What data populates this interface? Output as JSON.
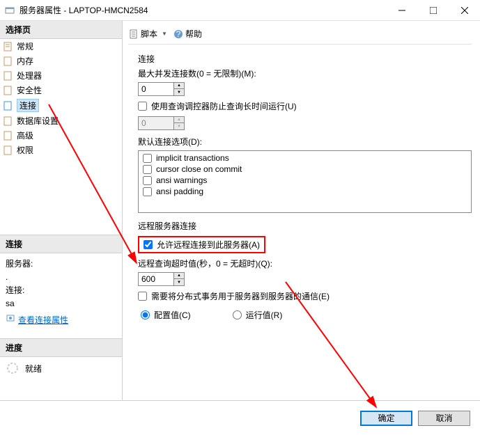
{
  "title": "服务器属性 - LAPTOP-HMCN2584",
  "sidebar": {
    "select_page": "选择页",
    "items": [
      {
        "label": "常规"
      },
      {
        "label": "内存"
      },
      {
        "label": "处理器"
      },
      {
        "label": "安全性"
      },
      {
        "label": "连接"
      },
      {
        "label": "数据库设置"
      },
      {
        "label": "高级"
      },
      {
        "label": "权限"
      }
    ],
    "connect_header": "连接",
    "server_label": "服务器:",
    "server_value": ".",
    "conn_label": "连接:",
    "conn_value": "sa",
    "view_props": "查看连接属性",
    "progress_header": "进度",
    "progress_status": "就绪"
  },
  "toolbar": {
    "script": "脚本",
    "help": "帮助"
  },
  "form": {
    "conn_label": "连接",
    "max_conn_label": "最大并发连接数(0 = 无限制)(M):",
    "max_conn_value": "0",
    "use_query_gov": "使用查询调控器防止查询长时间运行(U)",
    "gov_value": "0",
    "default_opts_label": "默认连接选项(D):",
    "opts": [
      "implicit transactions",
      "cursor close on commit",
      "ansi warnings",
      "ansi padding"
    ],
    "remote_header": "远程服务器连接",
    "allow_remote": "允许远程连接到此服务器(A)",
    "remote_timeout_label": "远程查询超时值(秒，0 = 无超时)(Q):",
    "remote_timeout_value": "600",
    "dist_trans": "需要将分布式事务用于服务器到服务器的通信(E)",
    "radio_config": "配置值(C)",
    "radio_run": "运行值(R)"
  },
  "buttons": {
    "ok": "确定",
    "cancel": "取消"
  }
}
